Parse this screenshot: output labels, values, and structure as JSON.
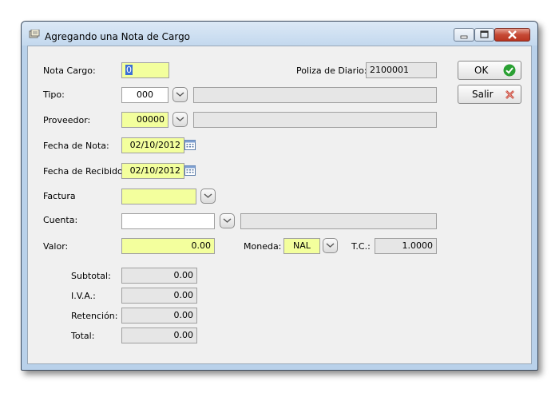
{
  "window": {
    "title": "Agregando una Nota de Cargo"
  },
  "form": {
    "nota_cargo": {
      "label": "Nota Cargo:",
      "value": "0"
    },
    "poliza": {
      "label": "Poliza de Diario:",
      "value": "2100001"
    },
    "tipo": {
      "label": "Tipo:",
      "value": "000",
      "description": ""
    },
    "proveedor": {
      "label": "Proveedor:",
      "value": "00000",
      "description": ""
    },
    "fecha_nota": {
      "label": "Fecha de Nota:",
      "value": "02/10/2012"
    },
    "fecha_recibido": {
      "label": "Fecha de Recibido:",
      "value": "02/10/2012"
    },
    "factura": {
      "label": "Factura",
      "value": ""
    },
    "cuenta": {
      "label": "Cuenta:",
      "value": "",
      "description": ""
    },
    "valor": {
      "label": "Valor:",
      "value": "0.00"
    },
    "moneda": {
      "label": "Moneda:",
      "value": "NAL"
    },
    "tc": {
      "label": "T.C.:",
      "value": "1.0000"
    }
  },
  "totals": {
    "subtotal": {
      "label": "Subtotal:",
      "value": "0.00"
    },
    "iva": {
      "label": "I.V.A.:",
      "value": "0.00"
    },
    "retencion": {
      "label": "Retención:",
      "value": "0.00"
    },
    "total": {
      "label": "Total:",
      "value": "0.00"
    }
  },
  "buttons": {
    "ok": "OK",
    "salir": "Salir"
  },
  "icons": {
    "ok": "check-circle-icon",
    "salir": "x-cancel-icon",
    "calendar": "calendar-icon",
    "dropdown": "chevron-down-icon"
  },
  "colors": {
    "required_field": "#f3ff9d",
    "readonly_field": "#e6e6e6",
    "ok_icon": "#2aa033",
    "cancel_icon": "#c0392b"
  }
}
